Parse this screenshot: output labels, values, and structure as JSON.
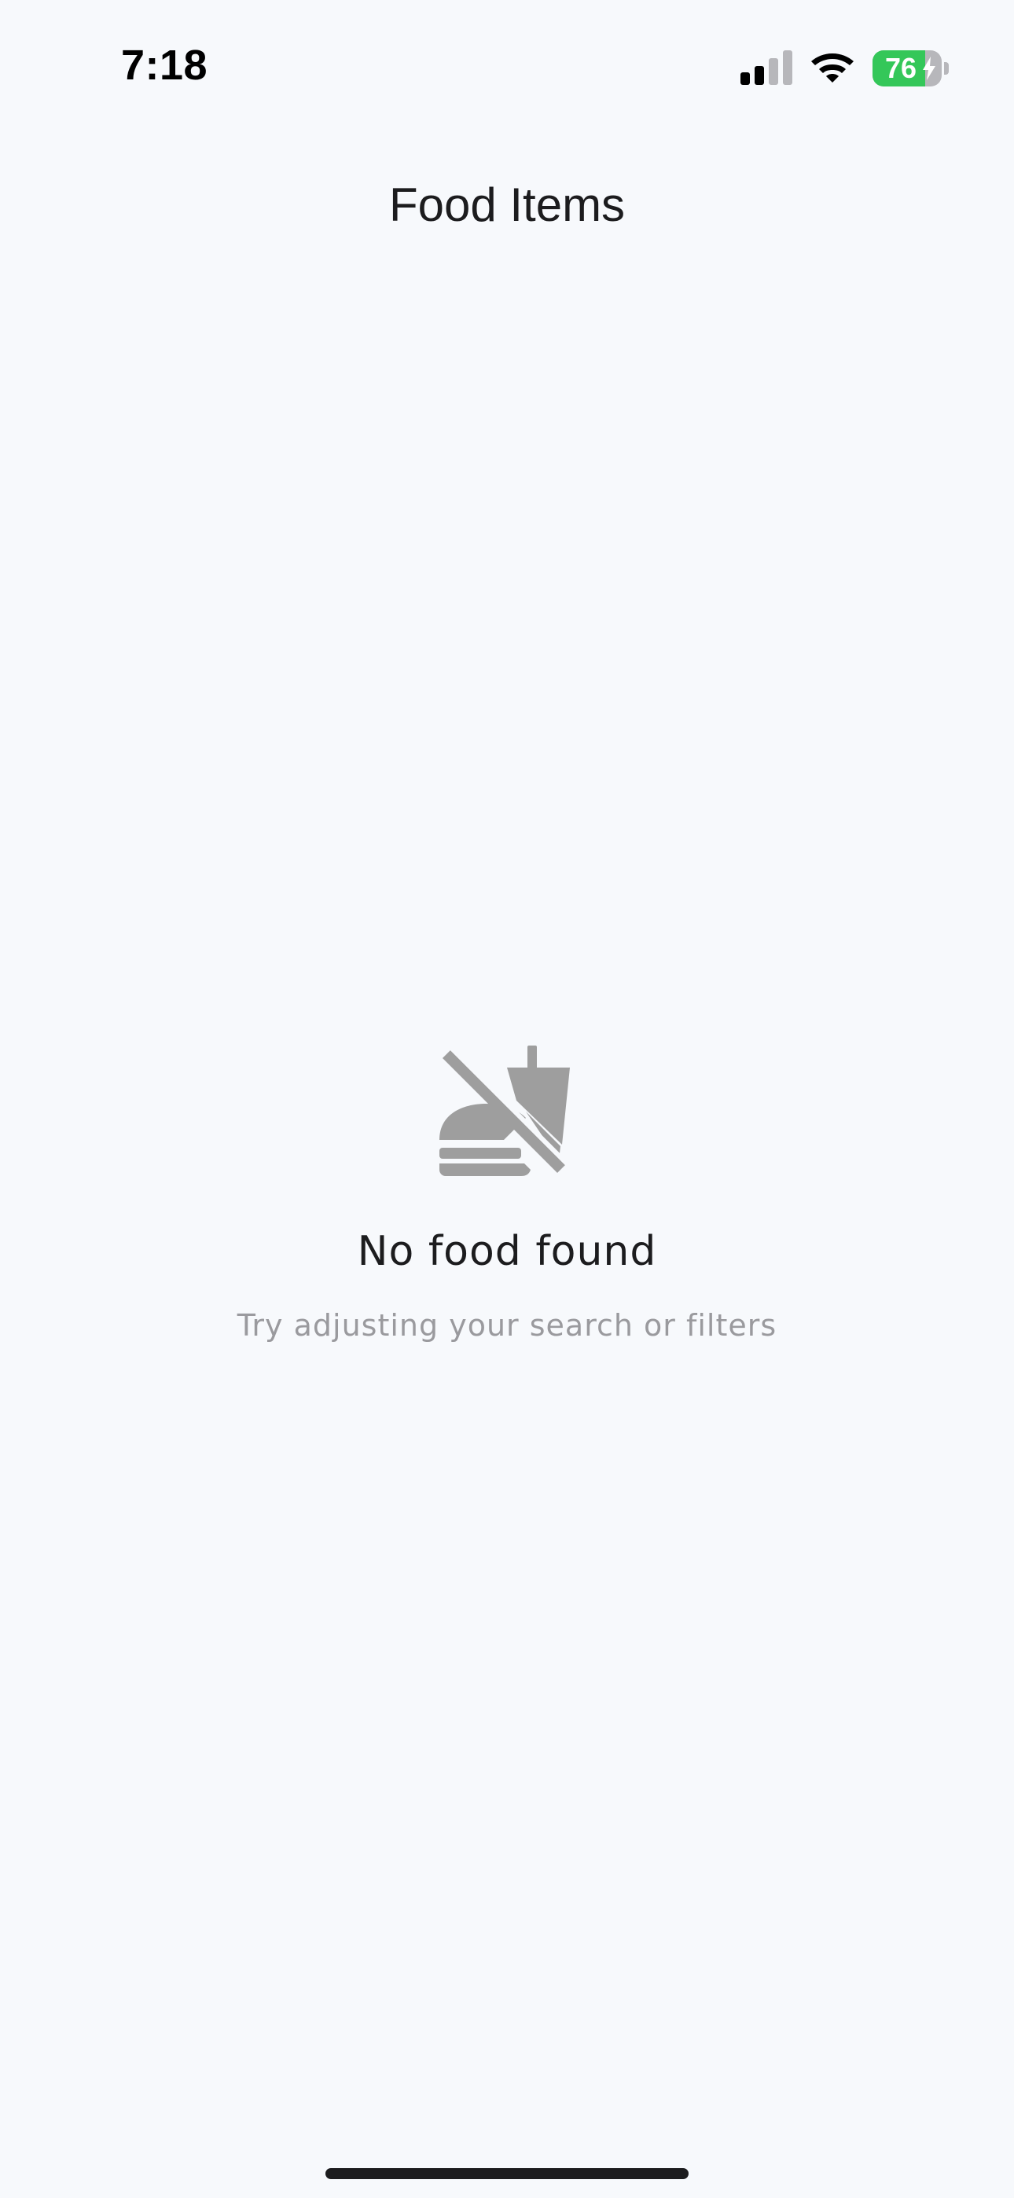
{
  "status_bar": {
    "time": "7:18",
    "battery_percent": 76,
    "battery_label": "76",
    "signal_bars_active": 2,
    "signal_bars_total": 4,
    "charging": true,
    "colors": {
      "battery_fill": "#34C759",
      "battery_empty": "#B7B7BB"
    }
  },
  "header": {
    "title": "Food Items"
  },
  "empty_state": {
    "icon": "no-food-icon",
    "title": "No food found",
    "subtitle": "Try adjusting your search or filters",
    "icon_color": "#9E9E9E"
  }
}
